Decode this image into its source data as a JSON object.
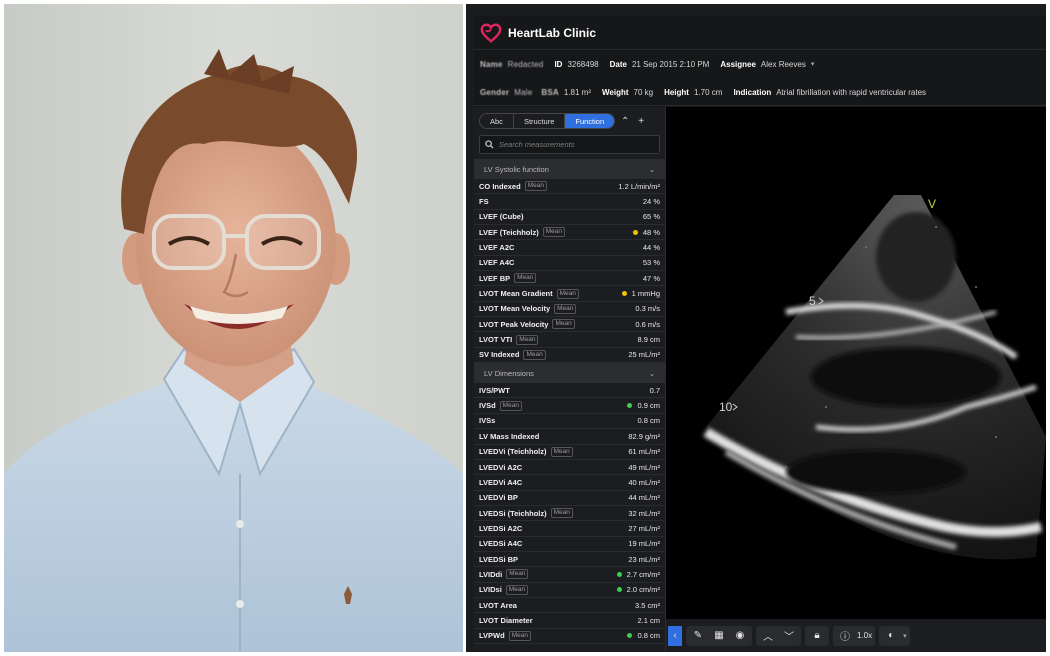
{
  "app": {
    "brand": "HeartLab Clinic",
    "accent_color": "#2f6fe0",
    "logo_color": "#e0245e"
  },
  "patient": {
    "name_label": "Name",
    "name_value": "Redacted",
    "id_label": "ID",
    "id_value": "3268498",
    "date_label": "Date",
    "date_value": "21 Sep 2015 2:10 PM",
    "assignee_label": "Assignee",
    "assignee_value": "Alex Reeves",
    "gender_label": "Gender",
    "gender_value": "Male",
    "bsa_label": "BSA",
    "bsa_value": "1.81 m²",
    "weight_label": "Weight",
    "weight_value": "70 kg",
    "height_label": "Height",
    "height_value": "1.70 cm",
    "indication_label": "Indication",
    "indication_value": "Atrial fibrillation with rapid ventricular rates"
  },
  "panel": {
    "tabs": [
      {
        "label": "Abc",
        "active": false
      },
      {
        "label": "Structure",
        "active": false
      },
      {
        "label": "Function",
        "active": true
      }
    ],
    "search_placeholder": "Search measurements",
    "sections": [
      {
        "title": "LV Systolic function",
        "rows": [
          {
            "name": "CO Indexed",
            "mean": true,
            "value": "1.2 L/min/m²",
            "dot": null
          },
          {
            "name": "FS",
            "mean": false,
            "value": "24 %",
            "dot": null
          },
          {
            "name": "LVEF (Cube)",
            "mean": false,
            "value": "65 %",
            "dot": null
          },
          {
            "name": "LVEF (Teichholz)",
            "mean": true,
            "value": "48 %",
            "dot": "#f2c200"
          },
          {
            "name": "LVEF A2C",
            "mean": false,
            "value": "44 %",
            "dot": null
          },
          {
            "name": "LVEF A4C",
            "mean": false,
            "value": "53 %",
            "dot": null
          },
          {
            "name": "LVEF BP",
            "mean": true,
            "value": "47 %",
            "dot": null
          },
          {
            "name": "LVOT Mean Gradient",
            "mean": true,
            "value": "1 mmHg",
            "dot": "#f2c200"
          },
          {
            "name": "LVOT Mean Velocity",
            "mean": true,
            "value": "0.3 m/s",
            "dot": null
          },
          {
            "name": "LVOT Peak Velocity",
            "mean": true,
            "value": "0.6 m/s",
            "dot": null
          },
          {
            "name": "LVOT VTI",
            "mean": true,
            "value": "8.9 cm",
            "dot": null
          },
          {
            "name": "SV Indexed",
            "mean": true,
            "value": "25 mL/m²",
            "dot": null
          }
        ]
      },
      {
        "title": "LV Dimensions",
        "rows": [
          {
            "name": "IVS/PWT",
            "mean": false,
            "value": "0.7",
            "dot": null
          },
          {
            "name": "IVSd",
            "mean": true,
            "value": "0.9 cm",
            "dot": "#3ccf4e"
          },
          {
            "name": "IVSs",
            "mean": false,
            "value": "0.8 cm",
            "dot": null
          },
          {
            "name": "LV Mass Indexed",
            "mean": false,
            "value": "82.9 g/m²",
            "dot": null
          },
          {
            "name": "LVEDVi (Teichholz)",
            "mean": true,
            "value": "61 mL/m²",
            "dot": null
          },
          {
            "name": "LVEDVi A2C",
            "mean": false,
            "value": "49 mL/m²",
            "dot": null
          },
          {
            "name": "LVEDVi A4C",
            "mean": false,
            "value": "40 mL/m²",
            "dot": null
          },
          {
            "name": "LVEDVi BP",
            "mean": false,
            "value": "44 mL/m²",
            "dot": null
          },
          {
            "name": "LVEDSi (Teichholz)",
            "mean": true,
            "value": "32 mL/m²",
            "dot": null
          },
          {
            "name": "LVEDSi A2C",
            "mean": false,
            "value": "27 mL/m²",
            "dot": null
          },
          {
            "name": "LVEDSi A4C",
            "mean": false,
            "value": "19 mL/m²",
            "dot": null
          },
          {
            "name": "LVEDSi BP",
            "mean": false,
            "value": "23 mL/m²",
            "dot": null
          },
          {
            "name": "LVIDdi",
            "mean": true,
            "value": "2.7 cm/m²",
            "dot": "#3ccf4e"
          },
          {
            "name": "LVIDsi",
            "mean": true,
            "value": "2.0 cm/m²",
            "dot": "#3ccf4e"
          },
          {
            "name": "LVOT Area",
            "mean": false,
            "value": "3.5 cm²",
            "dot": null
          },
          {
            "name": "LVOT Diameter",
            "mean": false,
            "value": "2.1 cm",
            "dot": null
          },
          {
            "name": "LVPWd",
            "mean": true,
            "value": "0.8 cm",
            "dot": "#3ccf4e"
          }
        ]
      }
    ],
    "mean_tag": "Mean"
  },
  "viewer": {
    "marker_label": "V",
    "depth_labels": [
      "5",
      "10"
    ]
  },
  "toolbar": {
    "zoom": "1.0x",
    "icons": [
      "chevron-left-icon",
      "ruler-icon",
      "calculator-icon",
      "eye-icon",
      "chevron-up-icon",
      "chevron-down-icon",
      "lock-icon",
      "info-icon",
      "contrast-icon"
    ]
  }
}
